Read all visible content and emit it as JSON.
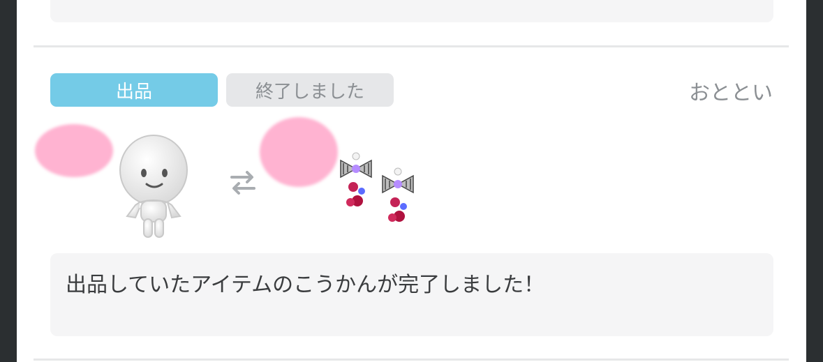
{
  "notification": {
    "listing_label": "出品",
    "status_label": "終了しました",
    "time_label": "おととい",
    "message": "出品していたアイテムのこうかんが完了しました！"
  },
  "icons": [
    "avatar-figure-icon",
    "swap-arrows-icon",
    "bow-cherry-hairpin-icon"
  ],
  "colors": {
    "listing_tag": "#74cbe7",
    "status_tag": "#e6e7e9",
    "censor_blob": "#ffb3d1"
  }
}
